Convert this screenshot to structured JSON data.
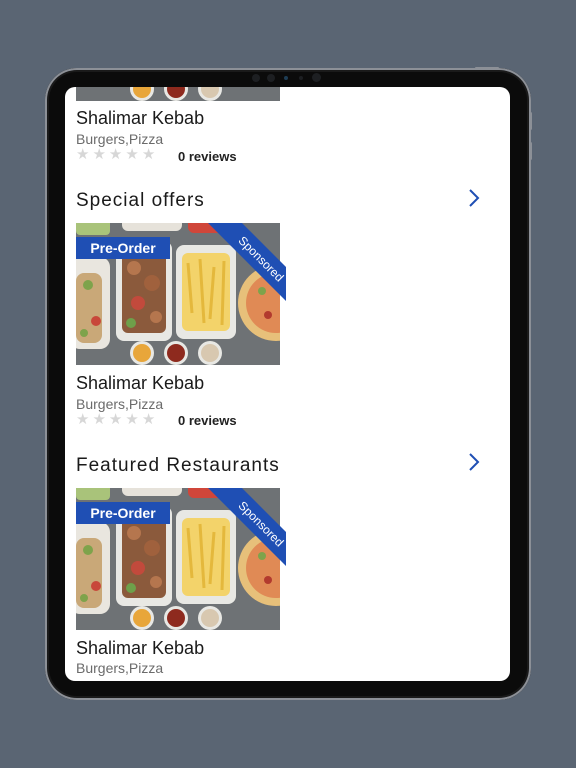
{
  "restaurants": [
    {
      "name": "Shalimar Kebab",
      "categories": "Burgers,Pizza",
      "rating": 0,
      "reviews": "0 reviews"
    },
    {
      "name": "Shalimar Kebab",
      "categories": "Burgers,Pizza",
      "rating": 0,
      "reviews": "0 reviews",
      "preorder": "Pre-Order",
      "sponsored": "Sponsored"
    },
    {
      "name": "Shalimar Kebab",
      "categories": "Burgers,Pizza",
      "preorder": "Pre-Order",
      "sponsored": "Sponsored"
    }
  ],
  "sections": {
    "special_offers": "Special offers",
    "featured_restaurants": "Featured Restaurants"
  },
  "icons": {
    "chevron": "chevron-right-icon",
    "star": "star-icon"
  },
  "colors": {
    "accent": "#1f4fb4",
    "background": "#5a6573",
    "star_empty": "#d7d7d7"
  }
}
